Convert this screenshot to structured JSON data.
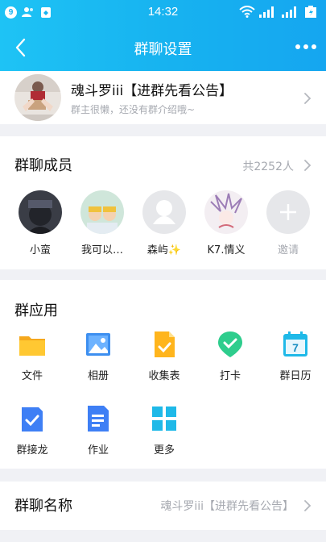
{
  "status_bar": {
    "time": "14:32",
    "notification_count": "9"
  },
  "title_bar": {
    "title": "群聊设置"
  },
  "group": {
    "name": "魂斗罗iii【进群先看公告】",
    "description": "群主很懒，还没有群介绍哦~"
  },
  "members_section": {
    "title": "群聊成员",
    "count": "共2252人",
    "members": [
      {
        "name": "小蛮"
      },
      {
        "name": "我可以…"
      },
      {
        "name": "森屿✨"
      },
      {
        "name": "K7.情义"
      },
      {
        "name": "邀请"
      }
    ]
  },
  "apps_section": {
    "title": "群应用",
    "apps": [
      {
        "label": "文件",
        "icon": "folder-icon"
      },
      {
        "label": "相册",
        "icon": "photo-album-icon"
      },
      {
        "label": "收集表",
        "icon": "form-icon"
      },
      {
        "label": "打卡",
        "icon": "checkin-icon"
      },
      {
        "label": "群日历",
        "icon": "calendar-icon"
      },
      {
        "label": "群接龙",
        "icon": "solitaire-icon"
      },
      {
        "label": "作业",
        "icon": "homework-icon"
      },
      {
        "label": "更多",
        "icon": "more-apps-icon"
      }
    ],
    "calendar_day": "7"
  },
  "name_row": {
    "title": "群聊名称",
    "value": "魂斗罗iii【进群先看公告】"
  },
  "colors": {
    "accent": "#17b3f0",
    "muted_text": "#a6a9b0",
    "background": "#f0f1f5"
  }
}
